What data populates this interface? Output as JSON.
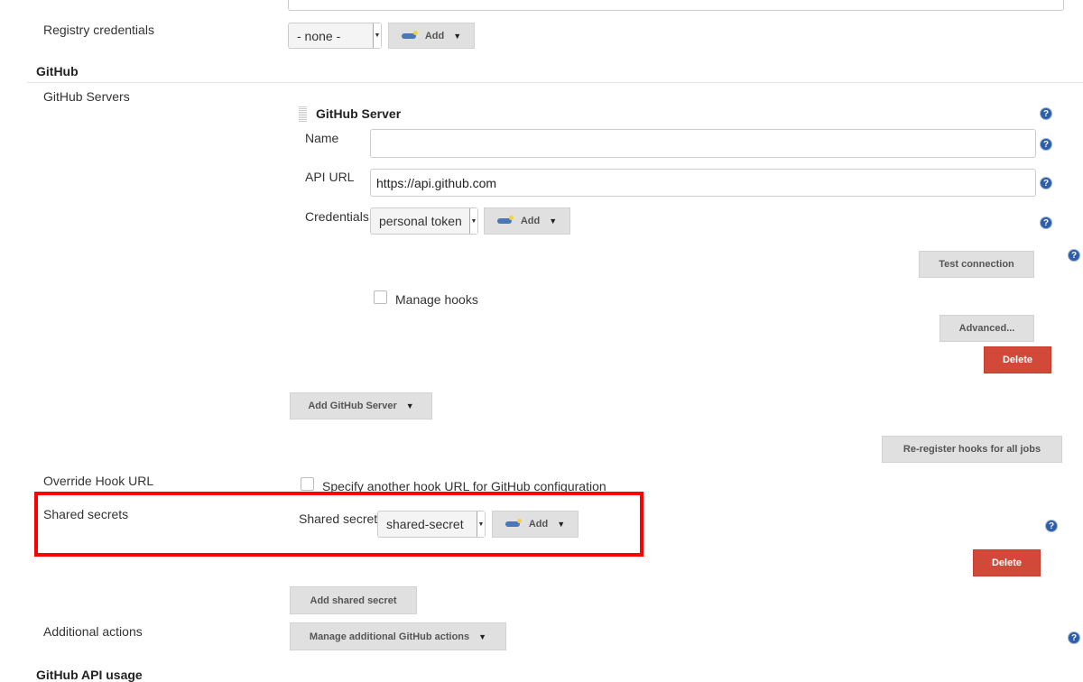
{
  "registry": {
    "label": "Registry credentials",
    "value": "- none -",
    "add": "Add"
  },
  "github": {
    "section": "GitHub",
    "servers_label": "GitHub Servers",
    "server": {
      "title": "GitHub Server",
      "name_label": "Name",
      "name_value": "",
      "api_label": "API URL",
      "api_value": "https://api.github.com",
      "cred_label": "Credentials",
      "cred_value": "personal token",
      "add": "Add",
      "test": "Test connection",
      "manage_hooks": "Manage hooks",
      "advanced": "Advanced...",
      "delete": "Delete"
    },
    "add_server": "Add GitHub Server",
    "reregister": "Re-register hooks for all jobs",
    "override_label": "Override Hook URL",
    "override_cb": "Specify another hook URL for GitHub configuration",
    "shared_label": "Shared secrets",
    "shared_secret_label": "Shared secret",
    "shared_value": "shared-secret",
    "shared_add": "Add",
    "shared_delete": "Delete",
    "add_shared": "Add shared secret",
    "additional_label": "Additional actions",
    "manage_actions": "Manage additional GitHub actions",
    "api_usage": "GitHub API usage"
  },
  "colors": {
    "highlight": "#ff0000",
    "delete": "#d24939",
    "help": "#2d5ea8"
  }
}
